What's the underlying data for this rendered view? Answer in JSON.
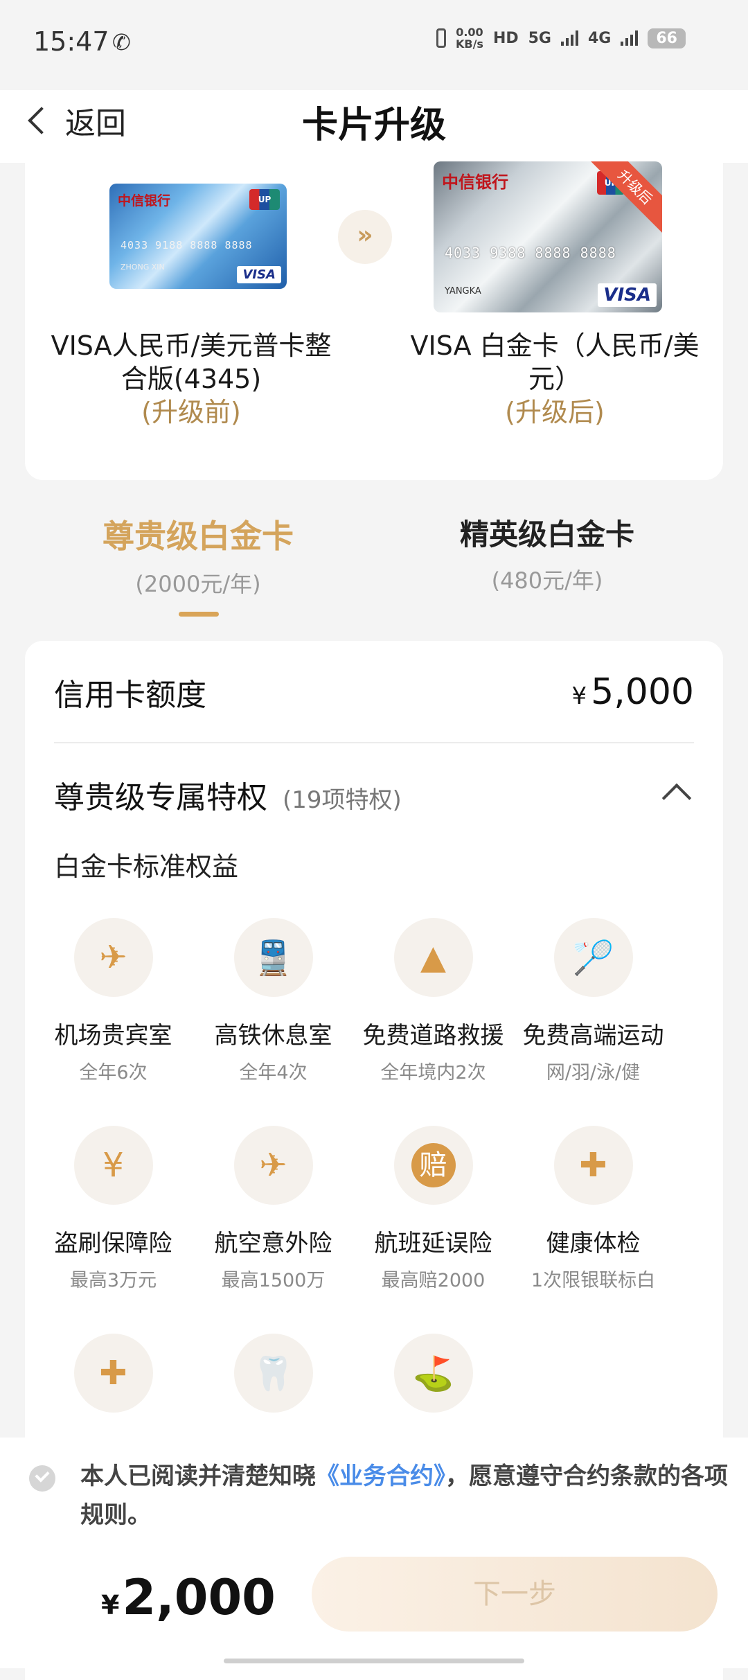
{
  "status_bar": {
    "time": "15:47",
    "net_speed_top": "0.00",
    "net_speed_unit": "KB/s",
    "hd": "HD",
    "sig1": "5G",
    "sig2": "4G",
    "battery": "66"
  },
  "header": {
    "back_label": "返回",
    "title": "卡片升级"
  },
  "upgrade": {
    "from": {
      "card_number": "4033 9188 8888 8888",
      "holder": "ZHONG XIN",
      "name": "VISA人民币/美元普卡整合版(4345)",
      "tag": "(升级前)"
    },
    "to": {
      "card_number": "4033 9388 8888 8888",
      "holder": "YANGKA",
      "name": "VISA 白金卡（人民币/美元）",
      "tag": "(升级后)",
      "ribbon": "升级后"
    },
    "arrow": "»",
    "bank_name": "中信银行",
    "visa": "VISA"
  },
  "tiers": [
    {
      "name": "尊贵级白金卡",
      "price": "(2000元/年)",
      "active": true
    },
    {
      "name": "精英级白金卡",
      "price": "(480元/年)",
      "active": false
    }
  ],
  "credit_limit": {
    "label": "信用卡额度",
    "currency": "¥",
    "value": "5,000"
  },
  "privileges": {
    "label": "尊贵级专属特权",
    "count": "(19项特权)",
    "section": "白金卡标准权益"
  },
  "benefits": [
    {
      "icon": "airplane-icon",
      "glyph": "✈",
      "title": "机场贵宾室",
      "sub": "全年6次"
    },
    {
      "icon": "train-icon",
      "glyph": "🚆",
      "title": "高铁休息室",
      "sub": "全年4次"
    },
    {
      "icon": "traffic-cone-icon",
      "glyph": "▲",
      "title": "免费道路救援",
      "sub": "全年境内2次"
    },
    {
      "icon": "shuttlecock-icon",
      "glyph": "🏸",
      "title": "免费高端运动",
      "sub": "网/羽/泳/健"
    },
    {
      "icon": "shield-yuan-icon",
      "glyph": "¥",
      "title": "盗刷保障险",
      "sub": "最高3万元"
    },
    {
      "icon": "broken-plane-icon",
      "glyph": "✈",
      "title": "航空意外险",
      "sub": "最高1500万"
    },
    {
      "icon": "compensation-icon",
      "glyph": "赔",
      "title": "航班延误险",
      "sub": "最高赔2000"
    },
    {
      "icon": "nurse-icon",
      "glyph": "✚",
      "title": "健康体检",
      "sub": "1次限银联标白"
    },
    {
      "icon": "medical-kit-icon",
      "glyph": "✚",
      "title": "",
      "sub": ""
    },
    {
      "icon": "tooth-icon",
      "glyph": "🦷",
      "title": "",
      "sub": ""
    },
    {
      "icon": "golf-icon",
      "glyph": "⛳",
      "title": "",
      "sub": ""
    }
  ],
  "agreement": {
    "prefix": "本人已阅读并清楚知晓",
    "link": "《业务合约》",
    "suffix": "，愿意遵守合约条款的各项规则。"
  },
  "footer": {
    "currency": "¥",
    "total": "2,000",
    "next_label": "下一步"
  }
}
